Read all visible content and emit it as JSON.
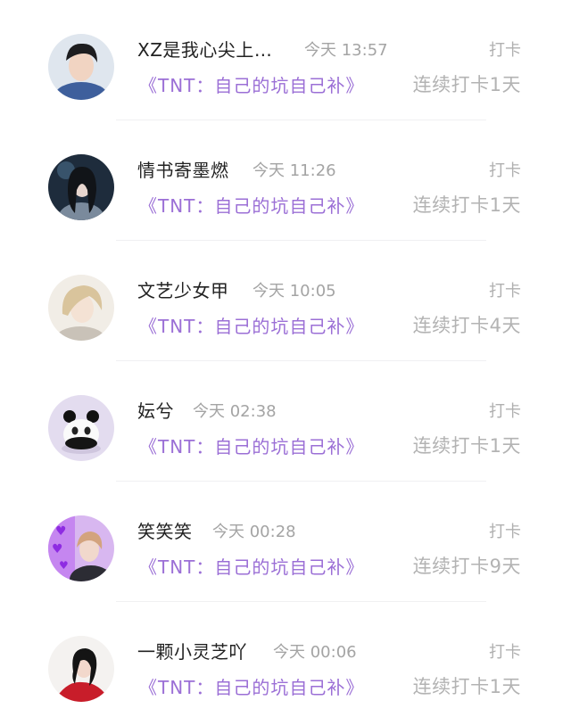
{
  "checkins": [
    {
      "username": "XZ是我心尖上…",
      "time": "今天 13:57",
      "action": "打卡",
      "topic": "《TNT：自己的坑自己补》",
      "streak": "连续打卡1天",
      "avatar_icon": "user-avatar-icon"
    },
    {
      "username": "情书寄墨燃",
      "time": "今天 11:26",
      "action": "打卡",
      "topic": "《TNT：自己的坑自己补》",
      "streak": "连续打卡1天",
      "avatar_icon": "user-avatar-icon"
    },
    {
      "username": "文艺少女甲",
      "time": "今天 10:05",
      "action": "打卡",
      "topic": "《TNT：自己的坑自己补》",
      "streak": "连续打卡4天",
      "avatar_icon": "user-avatar-icon"
    },
    {
      "username": "妘兮",
      "time": "今天 02:38",
      "action": "打卡",
      "topic": "《TNT：自己的坑自己补》",
      "streak": "连续打卡1天",
      "avatar_icon": "panda-avatar-icon"
    },
    {
      "username": "笑笑笑",
      "time": "今天 00:28",
      "action": "打卡",
      "topic": "《TNT：自己的坑自己补》",
      "streak": "连续打卡9天",
      "avatar_icon": "user-avatar-icon"
    },
    {
      "username": "一颗小灵芝吖",
      "time": "今天 00:06",
      "action": "打卡",
      "topic": "《TNT：自己的坑自己补》",
      "streak": "连续打卡1天",
      "avatar_icon": "user-avatar-icon"
    }
  ],
  "colors": {
    "topic_purple": "#9b6fd6",
    "muted_gray": "#b0b0b0",
    "name_text": "#222222"
  }
}
